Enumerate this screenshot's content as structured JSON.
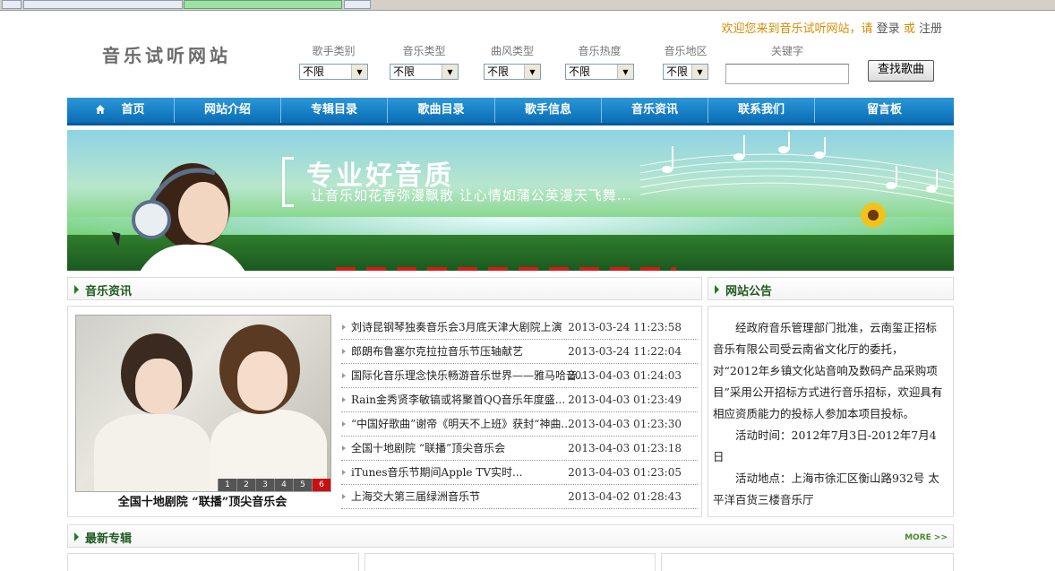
{
  "header": {
    "welcome_prefix": "欢迎您来到音乐试听网站，请",
    "login": "登录",
    "or": "或",
    "register": "注册",
    "logo": "音乐试听网站"
  },
  "filters": [
    {
      "label": "歌手类别",
      "value": "不限"
    },
    {
      "label": "音乐类型",
      "value": "不限"
    },
    {
      "label": "曲风类型",
      "value": "不限"
    },
    {
      "label": "音乐热度",
      "value": "不限"
    },
    {
      "label": "音乐地区",
      "value": "不限"
    }
  ],
  "keyword": {
    "label": "关键字",
    "value": ""
  },
  "search_button": "查找歌曲",
  "nav": [
    "首页",
    "网站介绍",
    "专辑目录",
    "歌曲目录",
    "歌手信息",
    "音乐资讯",
    "联系我们",
    "留言板"
  ],
  "banner": {
    "title": "专业好音质",
    "subtitle": "让音乐如花香弥漫飘散    让心情如蒲公英漫天飞舞..."
  },
  "sections": {
    "news": "音乐资讯",
    "notice": "网站公告",
    "albums": "最新专辑",
    "more": "MORE >>"
  },
  "slider": {
    "caption": "全国十地剧院 “联播”顶尖音乐会",
    "pages": [
      "1",
      "2",
      "3",
      "4",
      "5",
      "6"
    ],
    "active_page": "6"
  },
  "news": [
    {
      "title": "刘诗昆钢琴独奏音乐会3月底天津大剧院上演",
      "date": "2013-03-24 11:23:58"
    },
    {
      "title": "郎朗布鲁塞尔克拉拉音乐节压轴献艺",
      "date": "2013-03-24 11:22:04"
    },
    {
      "title": "国际化音乐理念快乐畅游音乐世界——雅马哈音...",
      "date": "2013-04-03 01:24:03"
    },
    {
      "title": "Rain金秀贤李敏镐或将聚首QQ音乐年度盛...",
      "date": "2013-04-03 01:23:49"
    },
    {
      "title": "“中国好歌曲”谢帝《明天不上班》获封“神曲...",
      "date": "2013-04-03 01:23:30"
    },
    {
      "title": "全国十地剧院 “联播”顶尖音乐会",
      "date": "2013-04-03 01:23:18"
    },
    {
      "title": "iTunes音乐节期间Apple TV实时...",
      "date": "2013-04-03 01:23:05"
    },
    {
      "title": "上海交大第三届绿洲音乐节",
      "date": "2013-04-02 01:28:43"
    }
  ],
  "notice": {
    "body": "经政府音乐管理部门批准，云南玺正招标音乐有限公司受云南省文化厅的委托，对“2012年乡镇文化站音响及数码产品采购项目”采用公开招标方式进行音乐招标，欢迎具有相应资质能力的投标人参加本项目投标。",
    "time": "活动时间：2012年7月3日-2012年7月4日",
    "place": "活动地点：上海市徐汇区衡山路932号 太平洋百货三楼音乐厅"
  },
  "colors": {
    "nav": "#0a6db5",
    "accent": "#d98b00",
    "section_title": "#1f5a1f",
    "active_page": "#c81010"
  }
}
